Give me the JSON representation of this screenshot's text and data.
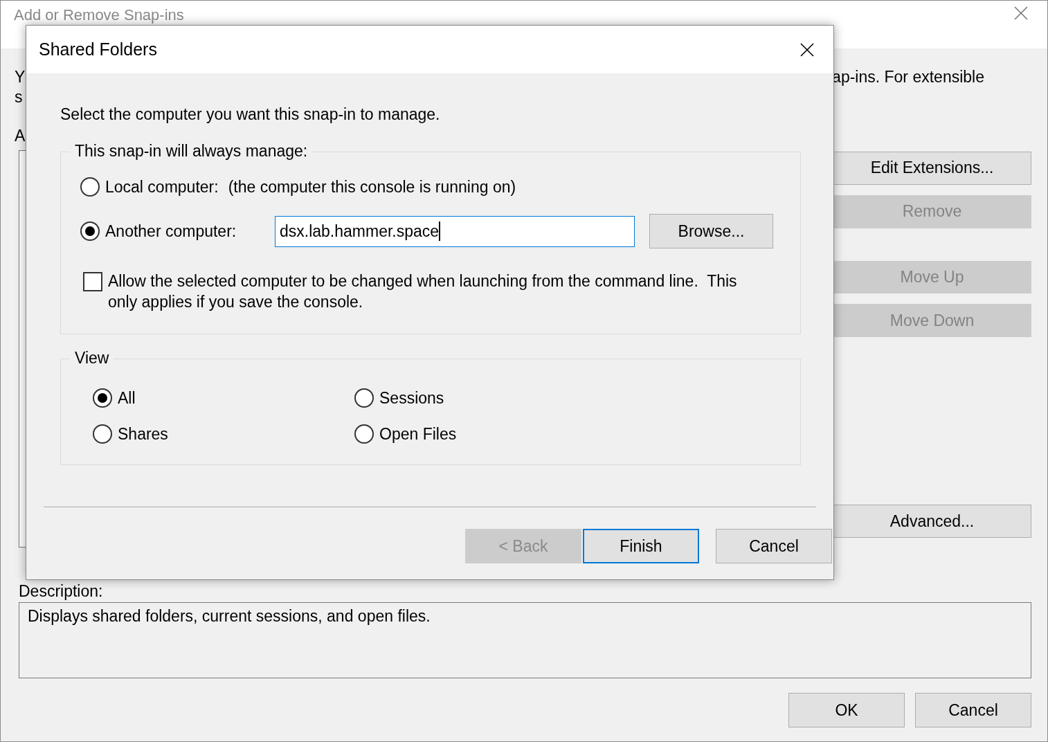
{
  "main_window": {
    "title": "Add or Remove Snap-ins",
    "intro_fragments": [
      "Y",
      "s"
    ],
    "intro_right": "ap-ins. For extensible",
    "list_label_fragment": "A",
    "side_buttons": [
      {
        "label": "Edit Extensions...",
        "disabled": false
      },
      {
        "label": "Remove",
        "disabled": true
      },
      {
        "label": "Move Up",
        "disabled": true
      },
      {
        "label": "Move Down",
        "disabled": true
      }
    ],
    "advanced_button": {
      "label": "Advanced...",
      "disabled": false
    },
    "description_label": "Description:",
    "description": "Displays shared folders, current sessions, and open files.",
    "buttons": [
      {
        "label": "OK"
      },
      {
        "label": "Cancel"
      }
    ]
  },
  "dialog": {
    "title": "Shared Folders",
    "prompt": "Select the computer you want this snap-in to manage.",
    "target_group": {
      "legend": "This snap-in will always manage:",
      "options": [
        {
          "label": "Local computer:",
          "note": "(the computer this console is running on)",
          "selected": false
        },
        {
          "label": "Another computer:",
          "selected": true
        }
      ],
      "computer_field": {
        "value": "dsx.lab.hammer.space"
      },
      "browse_button": "Browse...",
      "allow_change": {
        "label": "Allow the selected computer to be changed when launching from the command line.  This only applies if you save the console.",
        "checked": false
      }
    },
    "view_group": {
      "legend": "View",
      "options": [
        {
          "label": "All",
          "selected": true
        },
        {
          "label": "Sessions",
          "selected": false
        },
        {
          "label": "Shares",
          "selected": false
        },
        {
          "label": "Open Files",
          "selected": false
        }
      ]
    },
    "buttons": [
      {
        "label": "< Back",
        "disabled": true,
        "default": false
      },
      {
        "label": "Finish",
        "disabled": false,
        "default": true
      },
      {
        "label": "Cancel",
        "disabled": false,
        "default": false
      }
    ]
  }
}
